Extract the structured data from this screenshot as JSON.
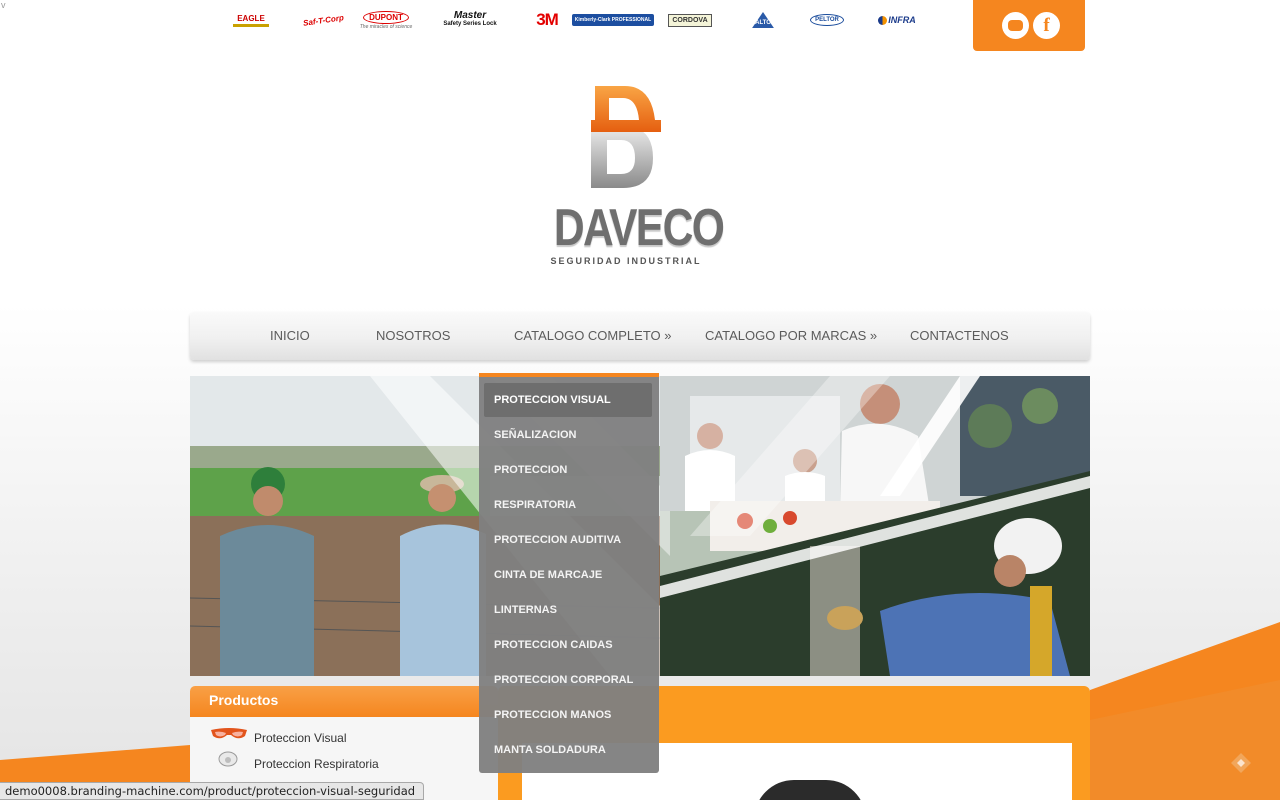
{
  "corner_mark": "v",
  "brands": [
    {
      "icon": "eagle-logo",
      "label": "EAGLE"
    },
    {
      "icon": "saf-t-corp-logo",
      "label": "Saf-T-Corp"
    },
    {
      "icon": "dupont-logo",
      "label": "DUPONT",
      "tagline": "The miracles of science"
    },
    {
      "icon": "master-lock-logo",
      "label": "Master",
      "sub": "Safety Series Lock"
    },
    {
      "icon": "3m-logo",
      "label": "3M"
    },
    {
      "icon": "kimberly-clark-logo",
      "label": "Kimberly-Clark PROFESSIONAL"
    },
    {
      "icon": "cordova-logo",
      "label": "CORDOVA"
    },
    {
      "icon": "alto-logo",
      "label": "ALTO"
    },
    {
      "icon": "peltor-logo",
      "label": "PELTOR"
    },
    {
      "icon": "infra-logo",
      "label": "INFRA"
    }
  ],
  "social": {
    "chat_icon": "chat-icon",
    "facebook_icon": "facebook-icon",
    "facebook_glyph": "f"
  },
  "logo": {
    "mark": "D",
    "name": "DAVECO",
    "tagline": "SEGURIDAD INDUSTRIAL"
  },
  "nav": {
    "inicio": "INICIO",
    "nosotros": "NOSOTROS",
    "catalogo": "CATALOGO COMPLETO »",
    "marcas": "CATALOGO POR MARCAS »",
    "contacto": "CONTACTENOS"
  },
  "dropdown": {
    "items": [
      "PROTECCION VISUAL",
      "SEÑALIZACION",
      "PROTECCION",
      "RESPIRATORIA",
      "PROTECCION AUDITIVA",
      "CINTA DE MARCAJE",
      "LINTERNAS",
      "PROTECCION CAIDAS",
      "PROTECCION CORPORAL",
      "PROTECCION MANOS",
      "MANTA SOLDADURA"
    ],
    "active_index": 0
  },
  "products": {
    "title": "Productos",
    "items": [
      {
        "label": "Proteccion Visual",
        "icon": "safety-glasses-icon"
      },
      {
        "label": "Proteccion Respiratoria",
        "icon": "respirator-icon"
      }
    ]
  },
  "status_url": "demo0008.branding-machine.com/product/proteccion-visual-seguridad",
  "colors": {
    "accent": "#f5861f",
    "dropdown_bg": "#808080",
    "nav_text": "#5b5b5b"
  }
}
